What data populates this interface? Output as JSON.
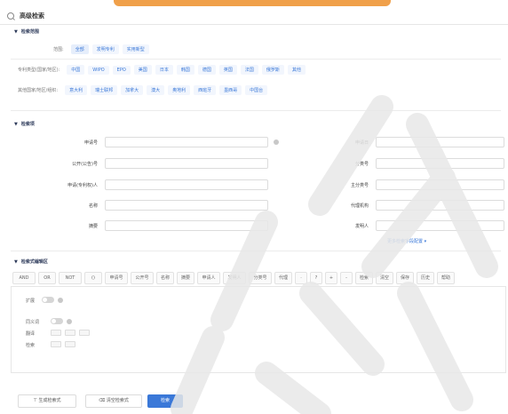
{
  "header": {
    "title": "高级检索"
  },
  "filter": {
    "title": "检索范围",
    "row1": {
      "label": "范围:",
      "chips": [
        "全部",
        "发明专利",
        "实用新型"
      ]
    },
    "row2": {
      "label": "专利类型(国家/地区):",
      "chips": [
        "中国",
        "WIPO",
        "EPO",
        "美国",
        "日本",
        "韩国",
        "德国",
        "英国",
        "法国",
        "俄罗斯",
        "其他"
      ]
    },
    "row3": {
      "label": "其他国家/地区/组织:",
      "chips": [
        "意大利",
        "瑞士联邦",
        "加拿大",
        "澳大",
        "奥地利",
        "西班牙",
        "墨西哥",
        "中国台"
      ]
    }
  },
  "search": {
    "title": "检索项",
    "fields": [
      {
        "label": "申请号",
        "placeholder": ""
      },
      {
        "label": "公开(公告)号",
        "placeholder": ""
      },
      {
        "label": "申请(专利权)人",
        "placeholder": ""
      },
      {
        "label": "申请日",
        "placeholder": ""
      },
      {
        "label": "名称",
        "placeholder": ""
      },
      {
        "label": "分类号",
        "placeholder": ""
      },
      {
        "label": "摘要",
        "placeholder": ""
      },
      {
        "label": "主分类号",
        "placeholder": ""
      },
      {
        "label": "代理机构",
        "placeholder": ""
      },
      {
        "label": "发明人",
        "placeholder": ""
      }
    ],
    "more_link": "更多检索字段配置 ▾"
  },
  "expression": {
    "title": "检索式编辑区",
    "tools": [
      "AND",
      "OR",
      "NOT",
      "()",
      "申请号",
      "公开号",
      "名称",
      "摘要",
      "申请人",
      "发明人",
      "分类号",
      "代理",
      "·",
      "?",
      "+",
      "-",
      "检索",
      "清空",
      "保存",
      "历史",
      "帮助"
    ],
    "toggle_label": "扩展",
    "opt1_label": "同义词",
    "opt2_label": "翻译",
    "opt3_label": "检索"
  },
  "footer": {
    "btn1": "生成检索式",
    "btn2": "清空检索式",
    "btn3": "检索"
  }
}
